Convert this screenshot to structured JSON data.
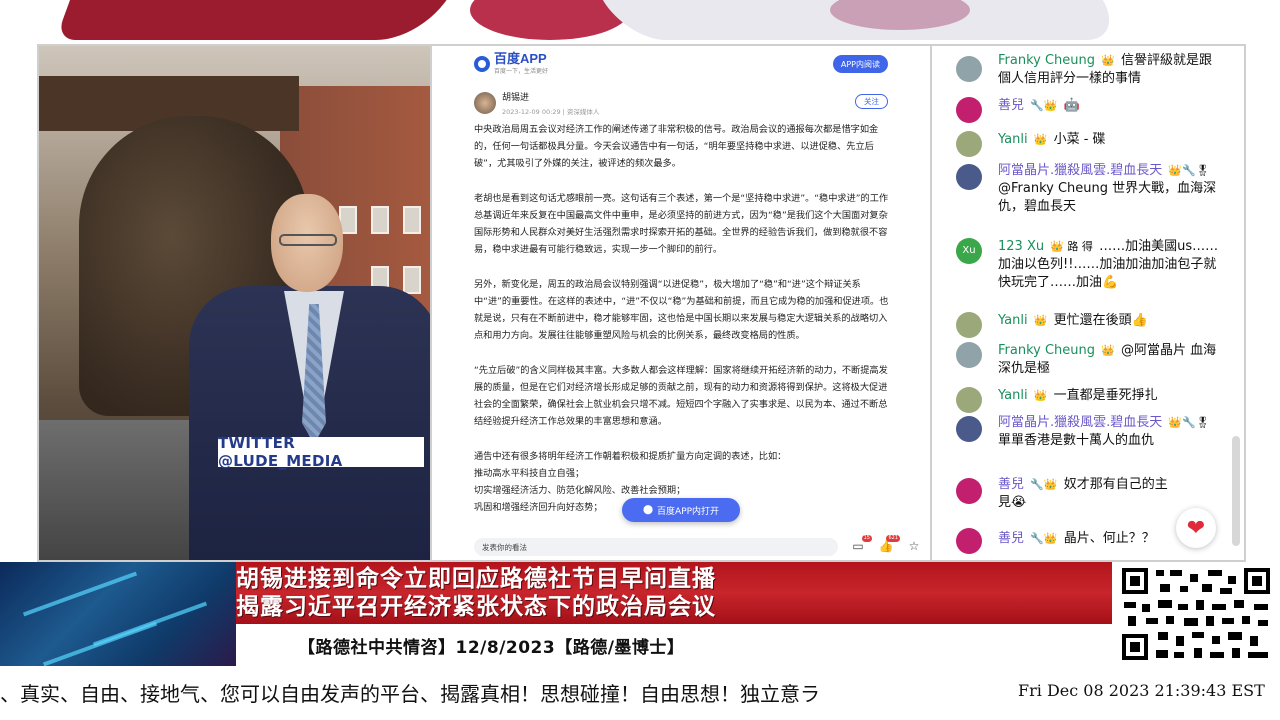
{
  "video": {
    "twitter_tag": "TWITTER  @LUDE_MEDIA"
  },
  "article": {
    "app_name": "百度APP",
    "app_slogan": "百度一下，生活更好",
    "open_in_app_pill": "APP内阅读",
    "author_name": "胡锡进",
    "author_meta": "2023-12-09 00:29 | 资深媒体人",
    "follow_label": "关注",
    "paragraphs": [
      "中央政治局周五会议对经济工作的阐述传递了非常积极的信号。政治局会议的通报每次都是惜字如金的，任何一句话都极具分量。今天会议通告中有一句话，“明年要坚持稳中求进、以进促稳、先立后破”，尤其吸引了外媒的关注，被评述的频次最多。",
      "老胡也是看到这句话尤感眼前一亮。这句话有三个表述，第一个是“坚持稳中求进”。“稳中求进”的工作总基调近年来反复在中国最高文件中重申，是必须坚持的前进方式，因为“稳”是我们这个大国面对复杂国际形势和人民群众对美好生活强烈需求时探索开拓的基础。全世界的经验告诉我们，做到稳就很不容易，稳中求进最有可能行稳致远，实现一步一个脚印的前行。",
      "另外，新变化是，周五的政治局会议特别强调“以进促稳”，极大增加了“稳”和“进”这个辩证关系中“进”的重要性。在这样的表述中，“进”不仅以“稳”为基础和前提，而且它成为稳的加强和促进项。也就是说，只有在不断前进中，稳才能够牢固，这也恰是中国长期以来发展与稳定大逻辑关系的战略切入点和用力方向。发展往往能够重塑风险与机会的比例关系，最终改变格局的性质。",
      "“先立后破”的含义同样极其丰富。大多数人都会这样理解：国家将继续开拓经济新的动力，不断提高发展的质量，但是在它们对经济增长形成足够的贡献之前，现有的动力和资源将得到保护。这将极大促进社会的全面繁荣，确保社会上就业机会只增不减。短短四个字融入了实事求是、以民为本、通过不断总结经验提升经济工作总效果的丰富思想和意涵。"
    ],
    "list_intro": "通告中还有很多将明年经济工作朝着积极和提质扩量方向定调的表述，比如：",
    "list_items": [
      "推动高水平科技自立自强；",
      "切实增强经济活力、防范化解风险、改善社会预期；",
      "巩固和增强经济回升向好态势；"
    ],
    "float_open_label": "百度APP内打开",
    "comment_placeholder": "发表你的看法",
    "comment_count": "15",
    "like_count": "621"
  },
  "chat": {
    "messages": [
      {
        "name": "Franky Cheung",
        "badge": "👑",
        "text": "信譽評級就是跟個人信用評分一樣的事情",
        "avatar_color": "#8fa3a8"
      },
      {
        "name": "善兒",
        "badge": "🔧👑",
        "text": "🤖",
        "avatar_color": "#c21f6e"
      },
      {
        "name": "Yanli",
        "badge": "👑",
        "text": "小菜 - 碟",
        "avatar_color": "#9aa87a"
      },
      {
        "name": "阿當晶片.獵殺風雲.碧血長天",
        "badge": "👑🔧🎖",
        "text": "@Franky Cheung 世界大戰，血海深仇，碧血長天",
        "avatar_color": "#4a5a8a"
      },
      {
        "name": "123 Xu",
        "badge": "👑 路 得",
        "text": "……加油美國us……加油以色列!!……加油加油加油包子就快玩完了……加油💪",
        "avatar_color": "#3aa84a",
        "avatar_letter": "Xu"
      },
      {
        "name": "Yanli",
        "badge": "👑",
        "text": "更忙還在後頭👍",
        "avatar_color": "#9aa87a"
      },
      {
        "name": "Franky Cheung",
        "badge": "👑",
        "text": "@阿當晶片 血海深仇是極",
        "avatar_color": "#8fa3a8"
      },
      {
        "name": "Yanli",
        "badge": "👑",
        "text": "一直都是垂死掙扎",
        "avatar_color": "#9aa87a"
      },
      {
        "name": "阿當晶片.獵殺風雲.碧血長天",
        "badge": "👑🔧🎖",
        "text": "單單香港是數十萬人的血仇",
        "avatar_color": "#4a5a8a"
      },
      {
        "name": "善兒",
        "badge": "🔧👑",
        "text": "奴才那有自己的主見😭",
        "avatar_color": "#c21f6e"
      },
      {
        "name": "善兒",
        "badge": "🔧👑",
        "text": "晶片、何止？？",
        "avatar_color": "#c21f6e"
      }
    ]
  },
  "banner": {
    "title_line1": "胡锡进接到命令立即回应路德社节目早间直播",
    "title_line2": "揭露习近平召开经济紧张状态下的政治局会议",
    "subtitle": "【路德社中共情咨】12/8/2023【路德/墨博士】"
  },
  "ticker": {
    "scroll_text": "、真实、自由、接地气、您可以自由发声的平台、揭露真相！思想碰撞！自由思想！独立意ラ",
    "clock": "Fri Dec 08 2023 21:39:43 EST"
  },
  "colors": {
    "banner_red": "#c8252c",
    "chat_name_green": "#1a8f5c",
    "baidu_blue": "#3f66e8",
    "twitter_text": "#243a8a"
  }
}
